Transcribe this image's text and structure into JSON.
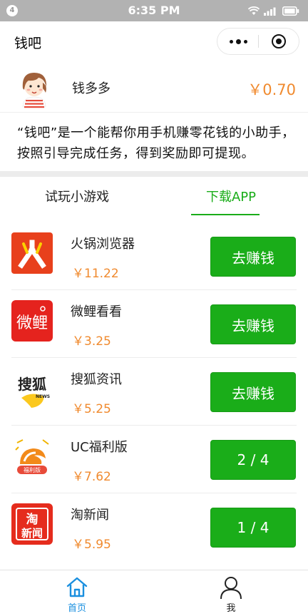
{
  "status_bar": {
    "badge": "4",
    "time": "6:35 PM"
  },
  "nav": {
    "title": "钱吧",
    "icons": [
      "more-dots-icon",
      "close-target-icon"
    ]
  },
  "profile": {
    "avatar": "avatar-girl",
    "username": "钱多多",
    "balance": "￥0.70"
  },
  "intro": "“钱吧”是一个能帮你用手机赚零花钱的小助手，按照引导完成任务，得到奖励即可提现。",
  "tabs": [
    {
      "label": "试玩小游戏",
      "active": false
    },
    {
      "label": "下载APP",
      "active": true
    }
  ],
  "apps": [
    {
      "name": "火锅浏览器",
      "reward": "￥11.22",
      "button": "去赚钱",
      "icon": "huoguo-browser-icon"
    },
    {
      "name": "微鲤看看",
      "reward": "￥3.25",
      "button": "去赚钱",
      "icon": "weili-kankan-icon"
    },
    {
      "name": "搜狐资讯",
      "reward": "￥5.25",
      "button": "去赚钱",
      "icon": "sohu-news-icon"
    },
    {
      "name": "UC福利版",
      "reward": "￥7.62",
      "button": "2 / 4",
      "icon": "uc-fuli-icon"
    },
    {
      "name": "淘新闻",
      "reward": "￥5.95",
      "button": "1 / 4",
      "icon": "tao-news-icon"
    }
  ],
  "icon_text": {
    "weili": "微鲤",
    "sohu": "搜狐",
    "sohu_news": "NEWS",
    "uc_badge": "福利版",
    "tao_top": "淘",
    "tao_bottom": "新闻"
  },
  "tabbar": [
    {
      "label": "首页",
      "icon": "home-icon",
      "active": true
    },
    {
      "label": "我",
      "icon": "user-icon",
      "active": false
    }
  ],
  "colors": {
    "green": "#1aad19",
    "orange": "#f08a2e",
    "blue": "#1a8fdf",
    "statusbar": "#b2b2b2"
  }
}
